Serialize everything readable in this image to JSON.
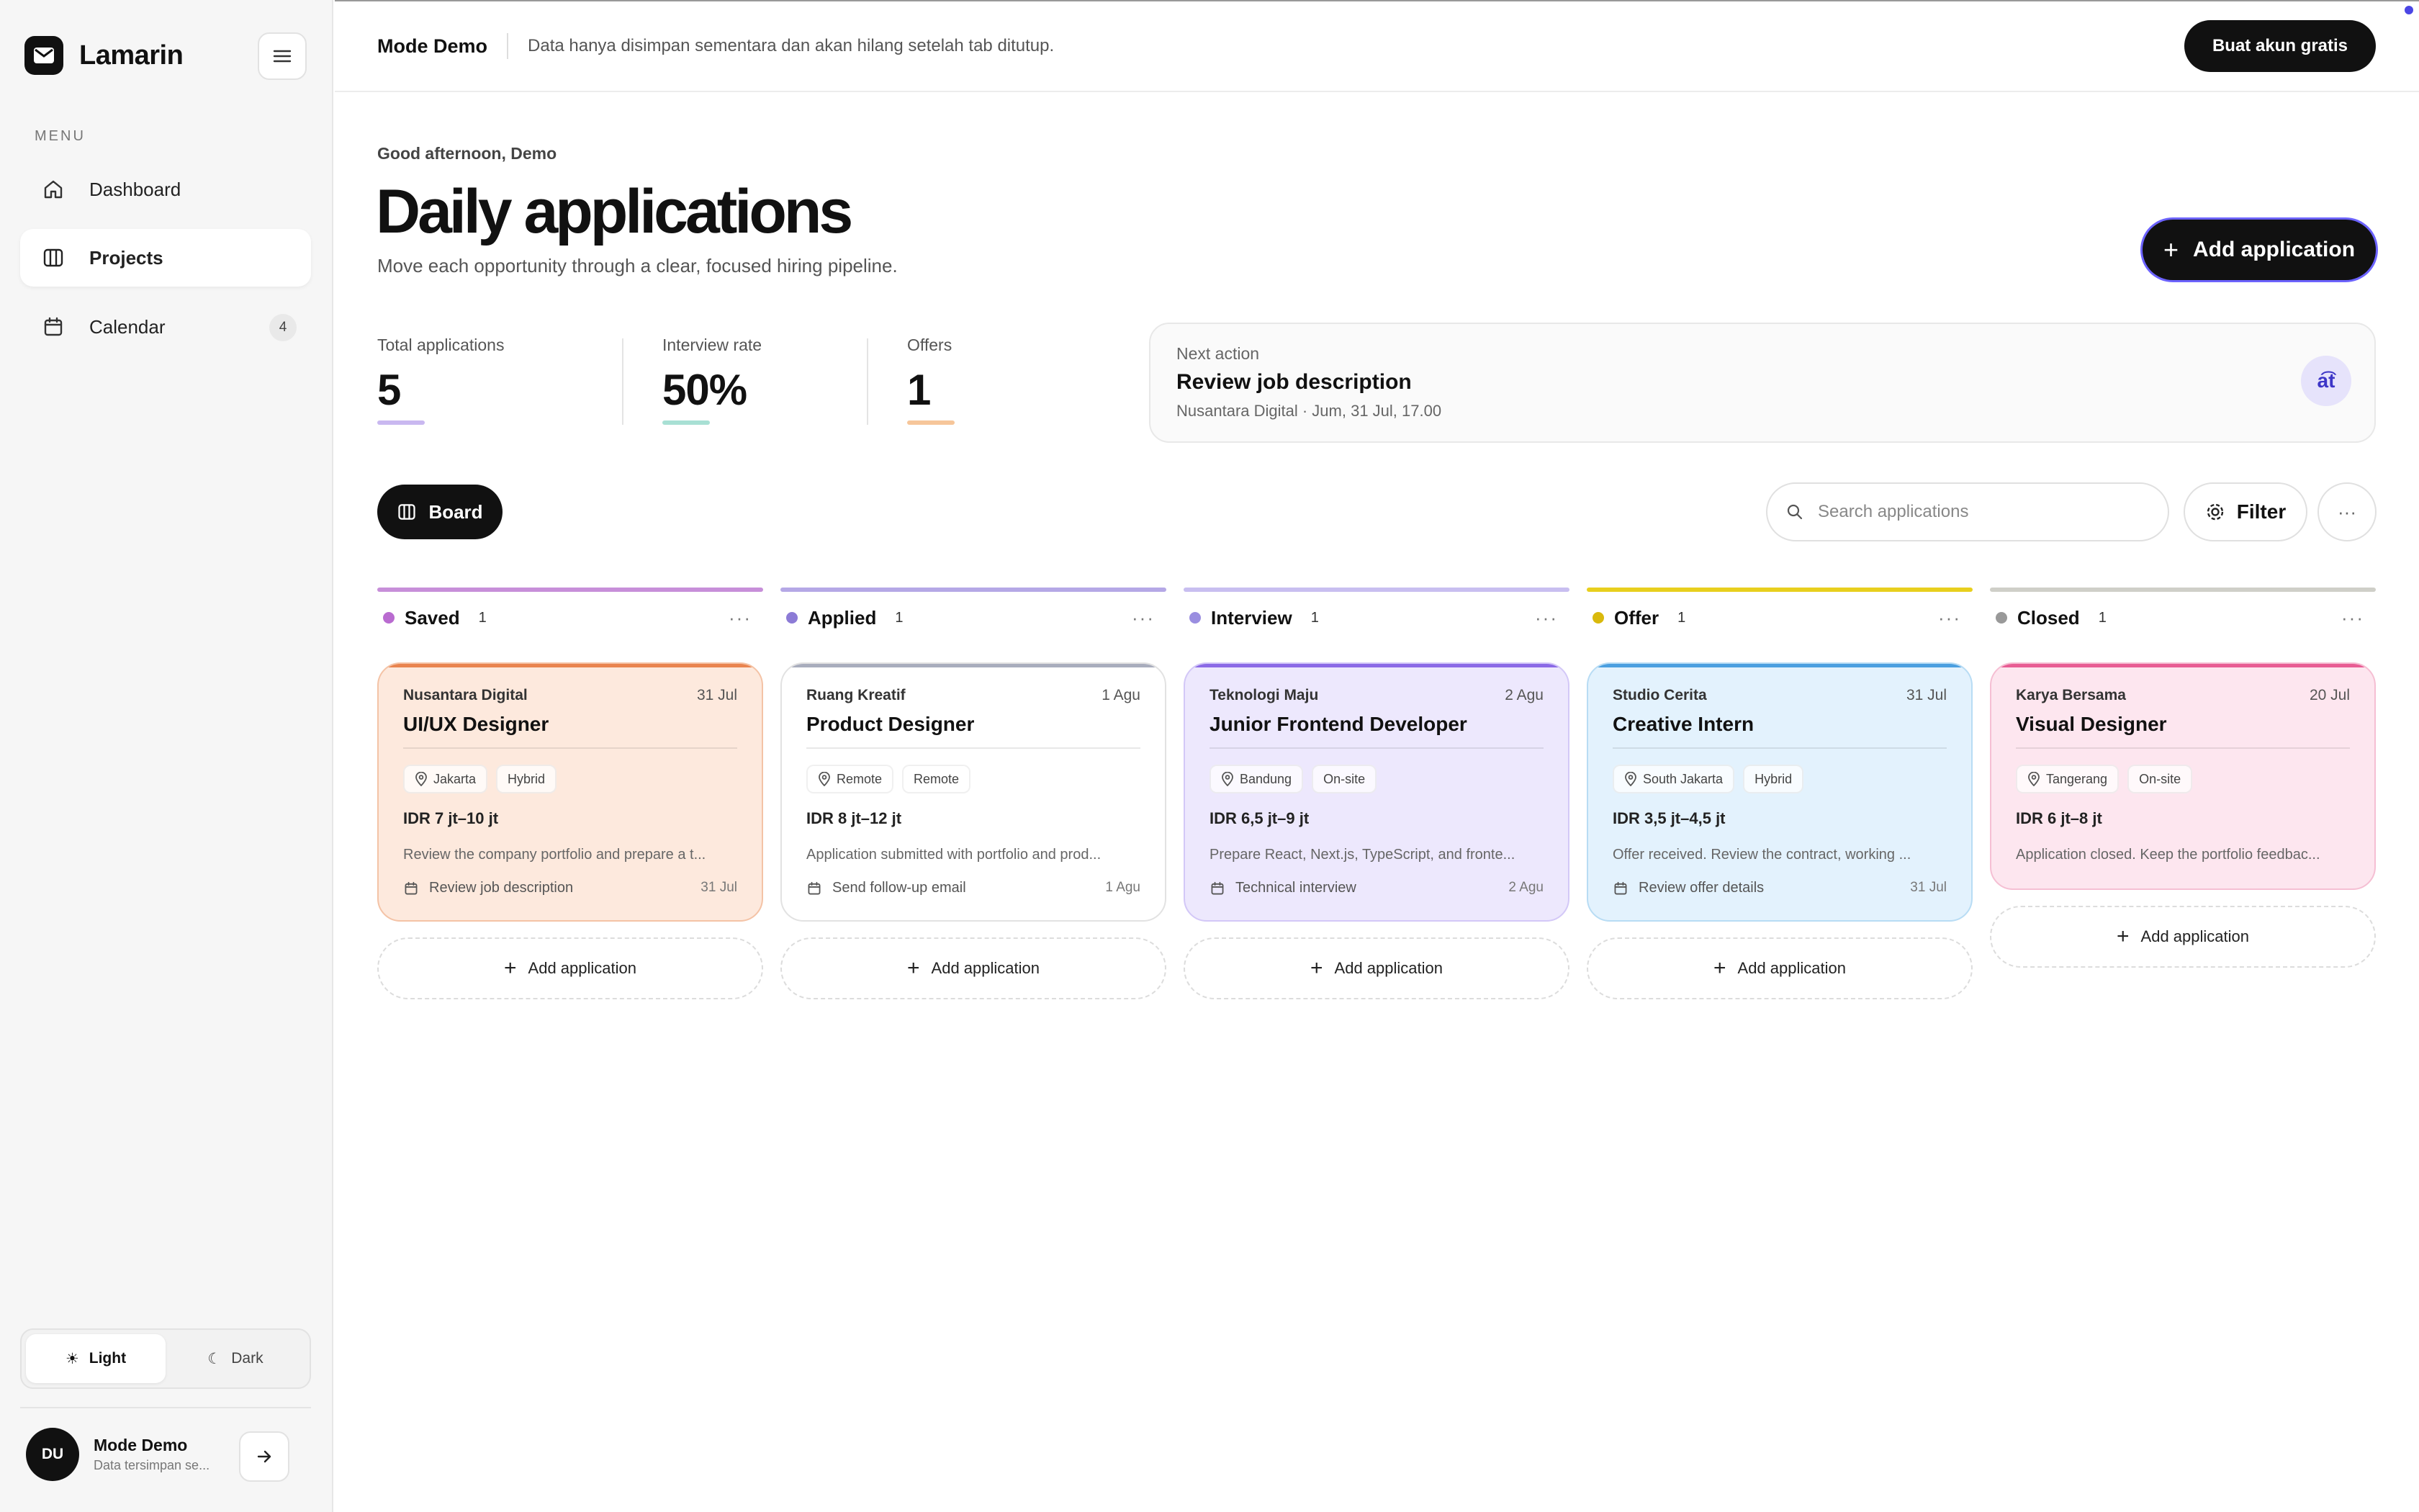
{
  "sidebar": {
    "brand": "Lamarin",
    "menu_heading": "MENU",
    "items": [
      {
        "label": "Dashboard"
      },
      {
        "label": "Projects"
      },
      {
        "label": "Calendar",
        "badge": "4"
      }
    ],
    "theme": {
      "light": "Light",
      "dark": "Dark"
    },
    "user": {
      "initials": "DU",
      "name": "Mode Demo",
      "subtitle": "Data tersimpan se..."
    }
  },
  "topbar": {
    "title": "Mode Demo",
    "note": "Data hanya disimpan sementara dan akan hilang setelah tab ditutup.",
    "signup": "Buat akun gratis"
  },
  "header": {
    "greeting": "Good afternoon, Demo",
    "title": "Daily applications",
    "subtitle": "Move each opportunity through a clear, focused hiring pipeline.",
    "add_button": "Add application"
  },
  "stats": [
    {
      "label": "Total applications",
      "value": "5",
      "color": "#c9b8f0"
    },
    {
      "label": "Interview rate",
      "value": "50%",
      "color": "#a8e0d4"
    },
    {
      "label": "Offers",
      "value": "1",
      "color": "#f6c69a"
    }
  ],
  "next_action": {
    "label": "Next action",
    "title": "Review job description",
    "meta": "Nusantara Digital · Jum, 31 Jul, 17.00",
    "icon": "translate-icon",
    "icon_text": "a͡t"
  },
  "toolbar": {
    "board": "Board",
    "search_placeholder": "Search applications",
    "filter": "Filter",
    "more": "···"
  },
  "columns": [
    {
      "name": "Saved",
      "count": "1",
      "line": "#c78fd9",
      "dot": "#b96bd0",
      "card": {
        "company": "Nusantara Digital",
        "date": "31 Jul",
        "role": "UI/UX Designer",
        "tags": [
          "Jakarta",
          "Hybrid"
        ],
        "salary": "IDR 7 jt–10 jt",
        "desc": "Review the company portfolio and prepare a t...",
        "task": "Review job description",
        "task_date": "31 Jul",
        "bg": "#fde9dd",
        "border": "#f4c3a6",
        "top": "#e9844f"
      },
      "add": "Add application"
    },
    {
      "name": "Applied",
      "count": "1",
      "line": "#b5a8e6",
      "dot": "#8c7bd6",
      "card": {
        "company": "Ruang Kreatif",
        "date": "1 Agu",
        "role": "Product Designer",
        "tags": [
          "Remote",
          "Remote"
        ],
        "salary": "IDR 8 jt–12 jt",
        "desc": "Application submitted with portfolio and prod...",
        "task": "Send follow-up email",
        "task_date": "1 Agu",
        "bg": "#ffffff",
        "border": "#e2e2e2",
        "top": "#a9adbd"
      },
      "add": "Add application"
    },
    {
      "name": "Interview",
      "count": "1",
      "line": "#c8bef0",
      "dot": "#9a8ee0",
      "card": {
        "company": "Teknologi Maju",
        "date": "2 Agu",
        "role": "Junior Frontend Developer",
        "tags": [
          "Bandung",
          "On-site"
        ],
        "salary": "IDR 6,5 jt–9 jt",
        "desc": "Prepare React, Next.js, TypeScript, and fronte...",
        "task": "Technical interview",
        "task_date": "2 Agu",
        "bg": "#ede8fd",
        "border": "#d3c8f7",
        "top": "#8b6ae6"
      },
      "add": "Add application"
    },
    {
      "name": "Offer",
      "count": "1",
      "line": "#e8cf1e",
      "dot": "#d9b90c",
      "card": {
        "company": "Studio Cerita",
        "date": "31 Jul",
        "role": "Creative Intern",
        "tags": [
          "South Jakarta",
          "Hybrid"
        ],
        "salary": "IDR 3,5 jt–4,5 jt",
        "desc": "Offer received. Review the contract, working ...",
        "task": "Review offer details",
        "task_date": "31 Jul",
        "bg": "#e3f2fd",
        "border": "#b8dcf4",
        "top": "#4b9fe0"
      },
      "add": "Add application"
    },
    {
      "name": "Closed",
      "count": "1",
      "line": "#cfcfc8",
      "dot": "#999999",
      "card": {
        "company": "Karya Bersama",
        "date": "20 Jul",
        "role": "Visual Designer",
        "tags": [
          "Tangerang",
          "On-site"
        ],
        "salary": "IDR 6 jt–8 jt",
        "desc": "Application closed. Keep the portfolio feedbac...",
        "task": "",
        "task_date": "",
        "bg": "#fde6ef",
        "border": "#f5bfd3",
        "top": "#e85d94"
      },
      "add": "Add application"
    }
  ]
}
